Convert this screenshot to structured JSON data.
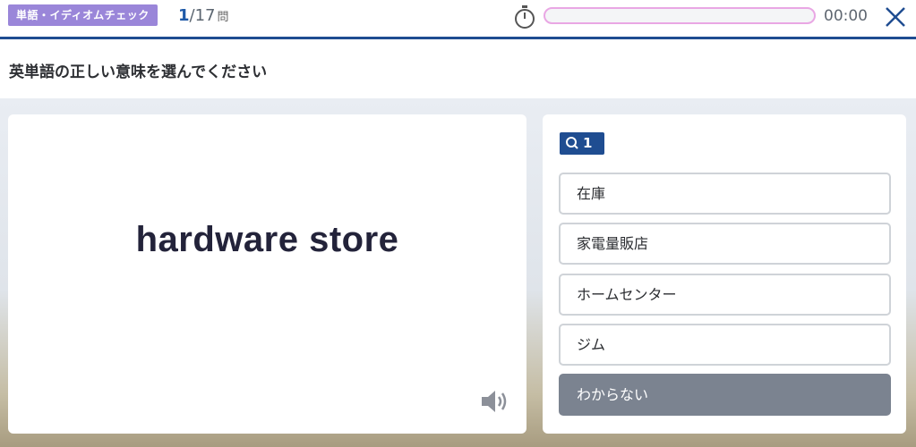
{
  "header": {
    "mode_label": "単語・イディオムチェック",
    "current": "1",
    "total_text": "/17",
    "unit": "問",
    "timer": "00:00",
    "progress": 0
  },
  "colors": {
    "accent_blue": "#1f4d91",
    "badge_purple": "#9a86d9",
    "progress_pink": "#e9a7e4",
    "dunno_gray": "#7b8390"
  },
  "question": {
    "instruction": "英単語の正しい意味を選んでください",
    "word": "hardware store",
    "number": "1"
  },
  "options": [
    {
      "label": "在庫"
    },
    {
      "label": "家電量販店"
    },
    {
      "label": "ホームセンター"
    },
    {
      "label": "ジム"
    }
  ],
  "dunno_label": "わからない",
  "icons": {
    "timer": "stopwatch-icon",
    "close": "close-icon",
    "speaker": "speaker-icon",
    "question": "search-icon"
  }
}
